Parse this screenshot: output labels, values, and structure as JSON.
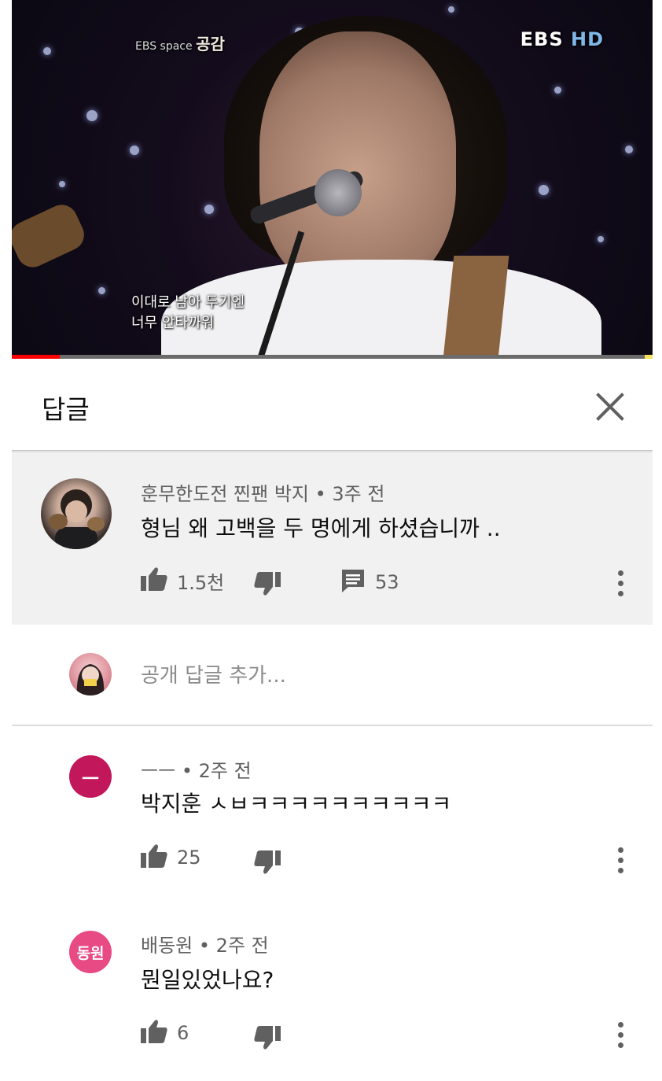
{
  "video": {
    "channel_logo": "EBS",
    "channel_logo_hd": "HD",
    "program_logo_small": "EBS space",
    "program_logo_big": "공감",
    "subtitle_line1": "이대로 남아 두기엔",
    "subtitle_line2": "너무 안타까워",
    "progress": 0.075,
    "progress_color": "#ff0000"
  },
  "header": {
    "title": "답글",
    "close_icon": "close-icon"
  },
  "main_comment": {
    "author": "훈무한도전 찐팬 박지",
    "time": "• 3주 전",
    "text": "형님 왜 고백을 두 명에게 하셨습니까 ..",
    "likes": "1.5천",
    "replies": "53"
  },
  "add_reply": {
    "placeholder": "공개 답글 추가..."
  },
  "replies": [
    {
      "author": "ㅡㅡ",
      "time": "• 2주 전",
      "text": "박지훈 ㅅㅂㅋㅋㅋㅋㅋㅋㅋㅋㅋㅋ",
      "likes": "25",
      "avatar_letter": "ㅡ",
      "avatar_color": "#c2185b"
    },
    {
      "author": "배동원",
      "time": "• 2주 전",
      "text": "뭔일있었나요?",
      "likes": "6",
      "avatar_letter": "동원",
      "avatar_color": "#e84a84"
    }
  ]
}
